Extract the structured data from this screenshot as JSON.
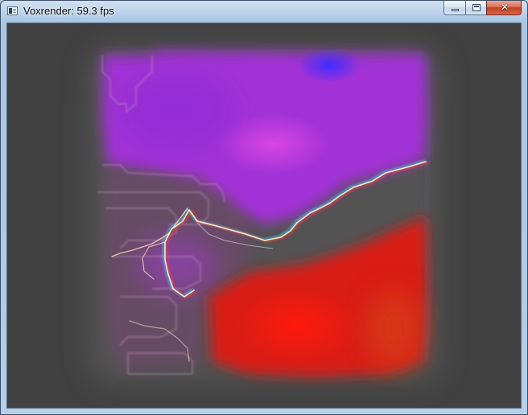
{
  "window": {
    "title": "Voxrender: 59.3 fps",
    "icon": "application-window-icon"
  },
  "caption_buttons": {
    "minimize_icon": "minimize-icon",
    "maximize_icon": "maximize-icon",
    "close_icon": "close-icon",
    "close_glyph": "✕"
  },
  "colors": {
    "client_background": "#414141",
    "volume_magenta": "#b63bd6",
    "volume_violet": "#8c32d8",
    "volume_red": "#f21610",
    "volume_orange_red": "#d8321a"
  }
}
